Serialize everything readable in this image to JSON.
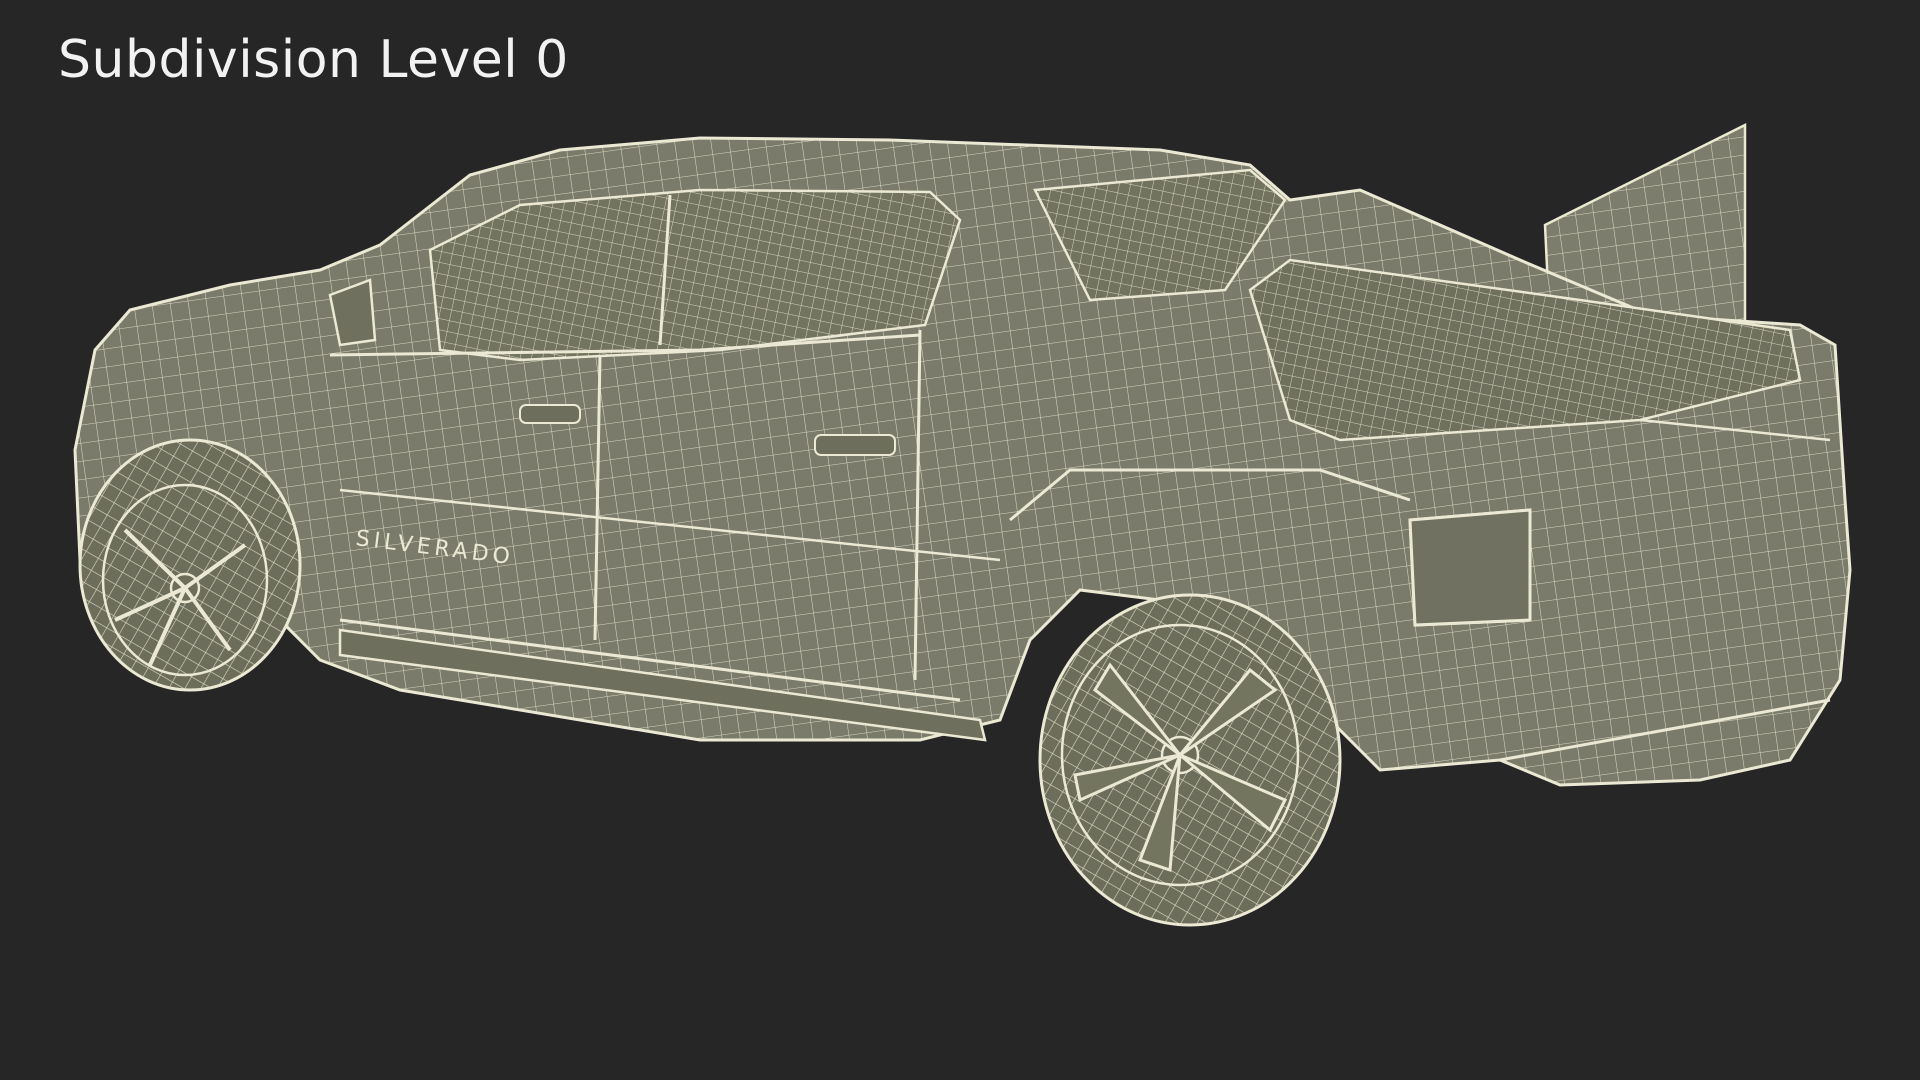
{
  "viewport": {
    "title": "Subdivision Level 0",
    "background_color": "#262626",
    "model_fill_color": "#7a7b6b",
    "wire_color": "#ebe9d4",
    "model": "pickup-truck-wireframe",
    "badge_text": "SILVERADO"
  }
}
